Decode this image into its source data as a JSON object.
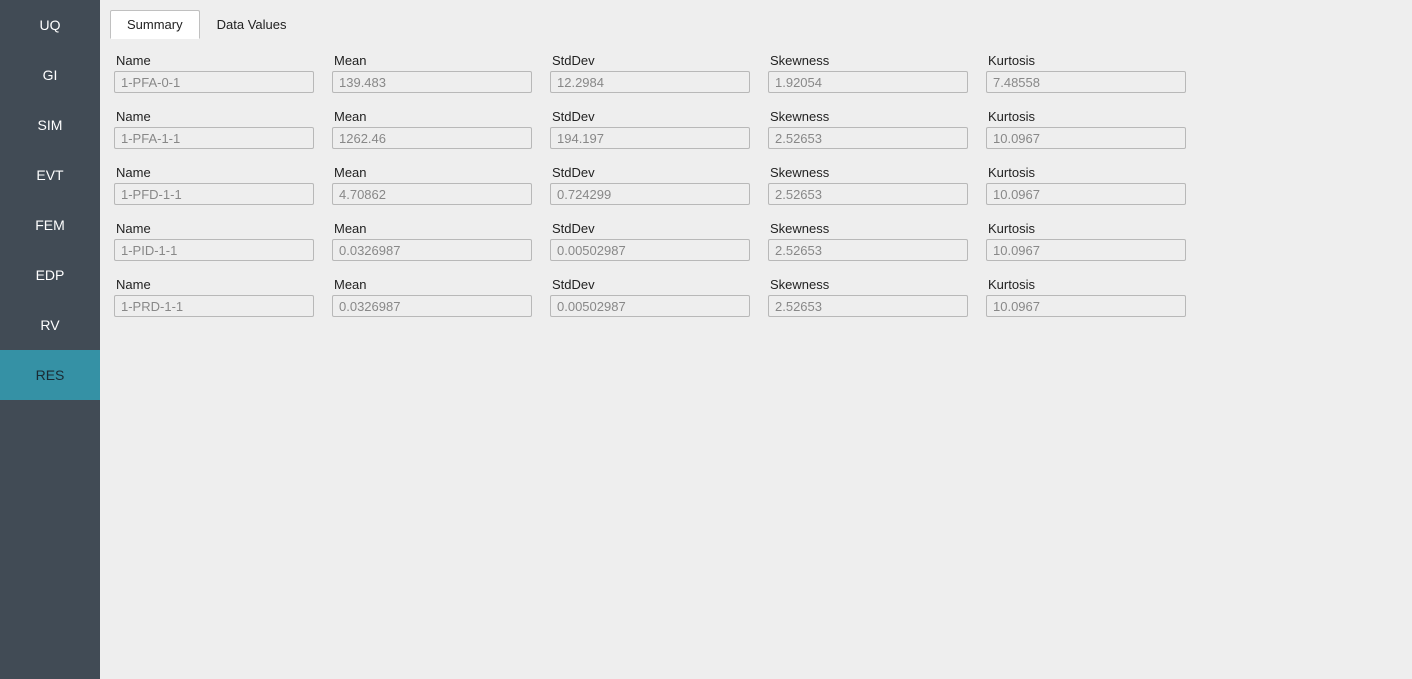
{
  "sidebar": {
    "items": [
      {
        "label": "UQ",
        "active": false
      },
      {
        "label": "GI",
        "active": false
      },
      {
        "label": "SIM",
        "active": false
      },
      {
        "label": "EVT",
        "active": false
      },
      {
        "label": "FEM",
        "active": false
      },
      {
        "label": "EDP",
        "active": false
      },
      {
        "label": "RV",
        "active": false
      },
      {
        "label": "RES",
        "active": true
      }
    ]
  },
  "tabs": [
    {
      "label": "Summary",
      "active": true
    },
    {
      "label": "Data Values",
      "active": false
    }
  ],
  "columns": {
    "name": "Name",
    "mean": "Mean",
    "stddev": "StdDev",
    "skewness": "Skewness",
    "kurtosis": "Kurtosis"
  },
  "rows": [
    {
      "name": "1-PFA-0-1",
      "mean": "139.483",
      "stddev": "12.2984",
      "skewness": "1.92054",
      "kurtosis": "7.48558"
    },
    {
      "name": "1-PFA-1-1",
      "mean": "1262.46",
      "stddev": "194.197",
      "skewness": "2.52653",
      "kurtosis": "10.0967"
    },
    {
      "name": "1-PFD-1-1",
      "mean": "4.70862",
      "stddev": "0.724299",
      "skewness": "2.52653",
      "kurtosis": "10.0967"
    },
    {
      "name": "1-PID-1-1",
      "mean": "0.0326987",
      "stddev": "0.00502987",
      "skewness": "2.52653",
      "kurtosis": "10.0967"
    },
    {
      "name": "1-PRD-1-1",
      "mean": "0.0326987",
      "stddev": "0.00502987",
      "skewness": "2.52653",
      "kurtosis": "10.0967"
    }
  ]
}
